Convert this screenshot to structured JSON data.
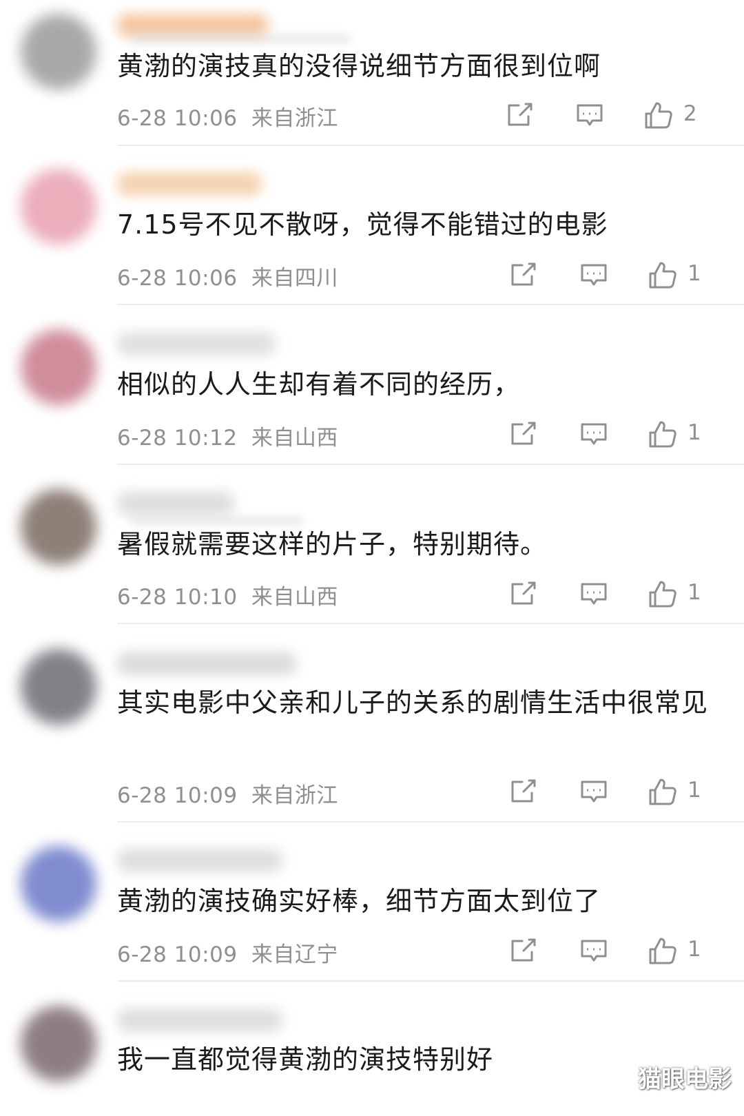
{
  "comments": [
    {
      "text": "黄渤的演技真的没得说细节方面很到位啊",
      "time": "6-28 10:06",
      "location": "来自浙江",
      "likes": "2"
    },
    {
      "text": "7.15号不见不散呀，觉得不能错过的电影",
      "time": "6-28 10:06",
      "location": "来自四川",
      "likes": "1"
    },
    {
      "text": "相似的人人生却有着不同的经历，",
      "time": "6-28 10:12",
      "location": "来自山西",
      "likes": "1"
    },
    {
      "text": "暑假就需要这样的片子，特别期待。",
      "time": "6-28 10:10",
      "location": "来自山西",
      "likes": "1"
    },
    {
      "text": "其实电影中父亲和儿子的关系的剧情生活中很常见",
      "time": "6-28 10:09",
      "location": "来自浙江",
      "likes": "1"
    },
    {
      "text": "黄渤的演技确实好棒，细节方面太到位了",
      "time": "6-28 10:09",
      "location": "来自辽宁",
      "likes": "1"
    },
    {
      "text": "我一直都觉得黄渤的演技特别好"
    }
  ],
  "watermark": "猫眼电影",
  "icons": {
    "share": "share-icon",
    "reply": "comment-icon",
    "like": "thumbs-up-icon"
  },
  "colors": {
    "text": "#1a1a1a",
    "meta": "#8f8f8f",
    "divider": "#ececec"
  }
}
